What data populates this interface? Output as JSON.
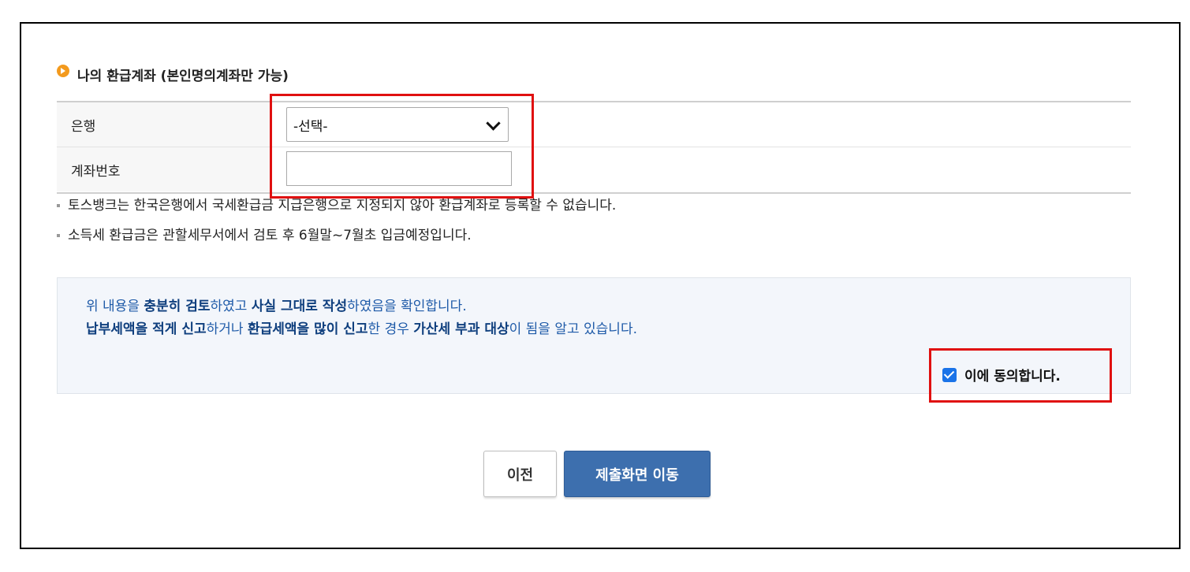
{
  "section": {
    "title": "나의 환급계좌 (본인명의계좌만 가능)",
    "icon": "orange-circle-arrow-icon"
  },
  "form": {
    "bank_label": "은행",
    "bank_selected": "-선택-",
    "account_label": "계좌번호",
    "account_value": ""
  },
  "notes": [
    "토스뱅크는 한국은행에서 국세환급금 지급은행으로 지정되지 않아 환급계좌로 등록할 수 없습니다.",
    "소득세 환급금은 관할세무서에서 검토 후 6월말~7월초 입금예정입니다."
  ],
  "confirm": {
    "line1": [
      {
        "text": "위 내용을 ",
        "bold": false
      },
      {
        "text": "충분히 검토",
        "bold": true
      },
      {
        "text": "하였고 ",
        "bold": false
      },
      {
        "text": "사실 그대로 작성",
        "bold": true
      },
      {
        "text": "하였음을 확인합니다.",
        "bold": false
      }
    ],
    "line2": [
      {
        "text": "납부세액을 적게 신고",
        "bold": true
      },
      {
        "text": "하거나 ",
        "bold": false
      },
      {
        "text": "환급세액을 많이 신고",
        "bold": true
      },
      {
        "text": "한 경우 ",
        "bold": false
      },
      {
        "text": "가산세 부과 대상",
        "bold": true
      },
      {
        "text": "이 됨을 알고 있습니다.",
        "bold": false
      }
    ],
    "agree_label": "이에 동의합니다.",
    "agree_checked": true
  },
  "buttons": {
    "prev": "이전",
    "submit": "제출화면 이동"
  },
  "colors": {
    "highlight": "#e01010",
    "primary_button": "#3d6fae",
    "confirm_text": "#1e5aa8"
  }
}
